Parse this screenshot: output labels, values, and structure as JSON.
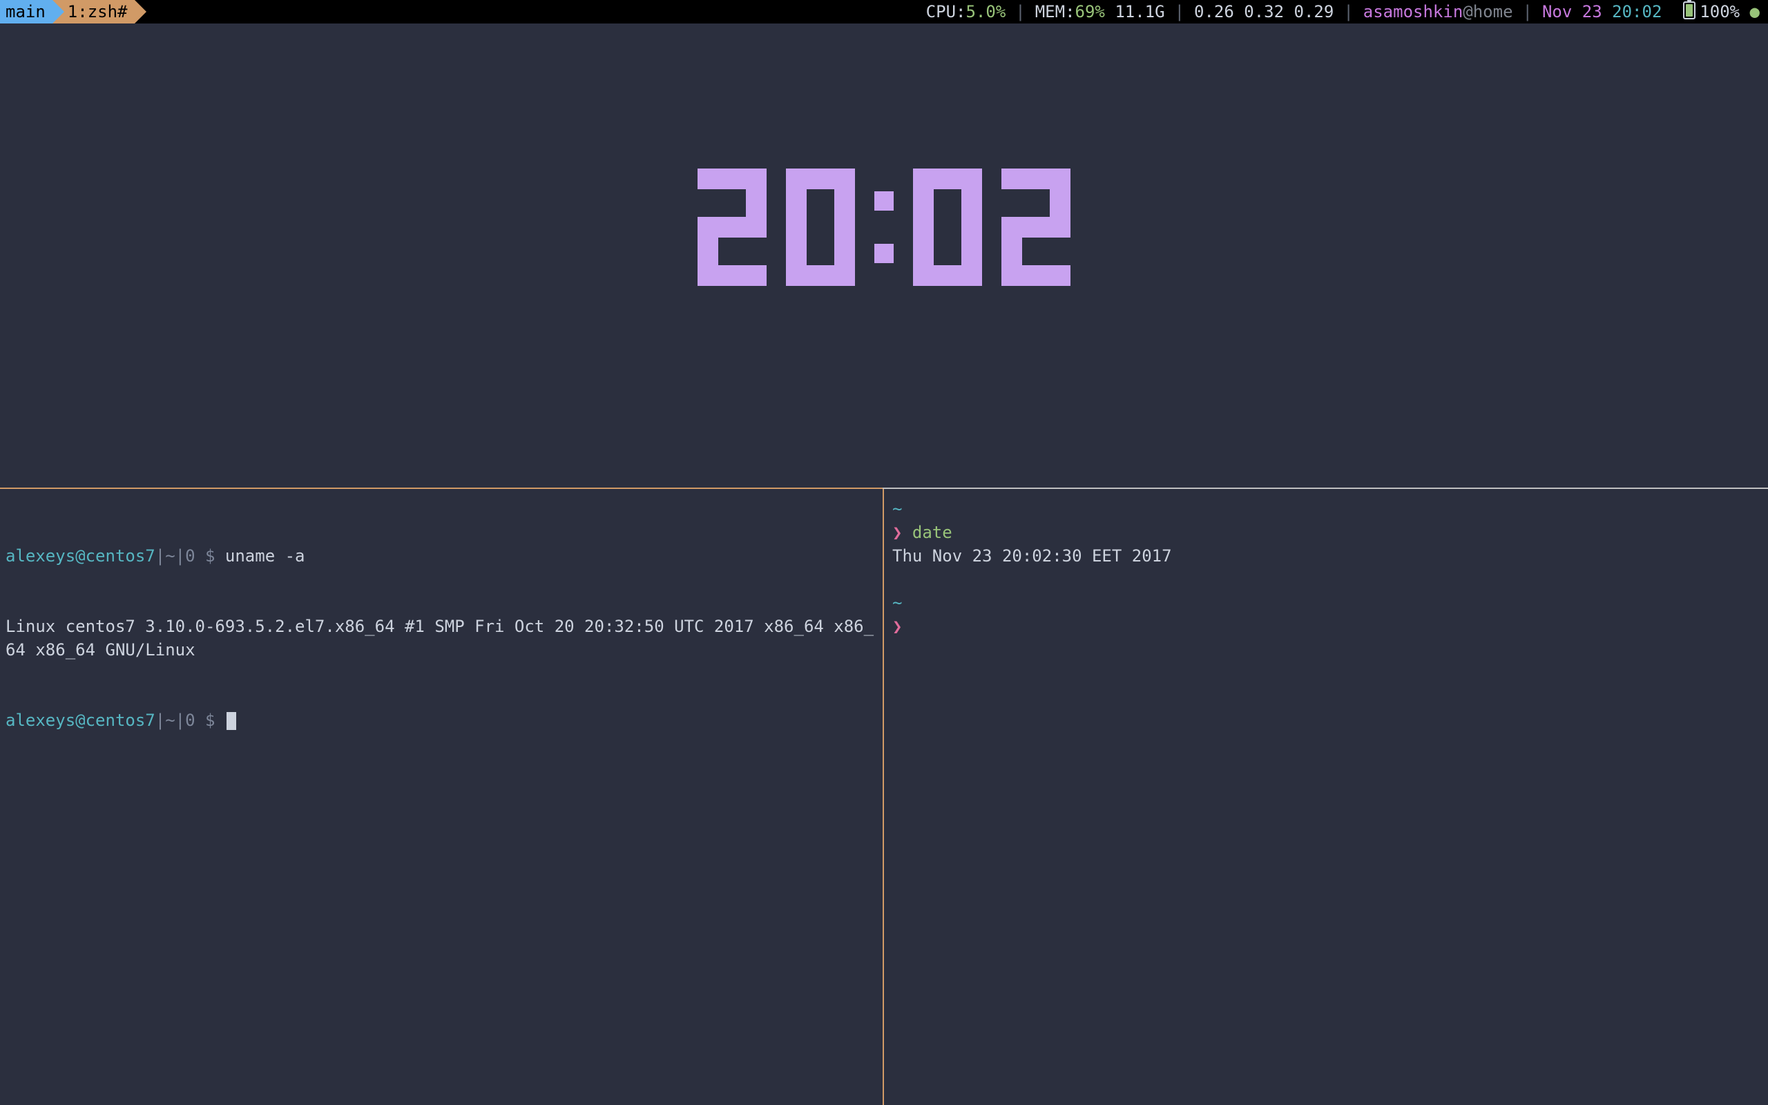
{
  "status": {
    "session": "main",
    "window": "1:zsh#",
    "cpu_label": "CPU:",
    "cpu_value": "5.0%",
    "mem_label": "MEM:",
    "mem_value": "69%",
    "mem_total": "11.1G",
    "load": "0.26 0.32 0.29",
    "user": "asamoshkin",
    "host": "@home",
    "date": "Nov 23",
    "time": "20:02",
    "battery_pct": "100%",
    "dot": "●",
    "sep": "|"
  },
  "clock": {
    "h1": "2",
    "h2": "0",
    "m1": "0",
    "m2": "2"
  },
  "left_pane": {
    "prompt_user": "alexeys@centos7",
    "prompt_path": "|~|0 $ ",
    "cmd1": "uname -a",
    "output1": "Linux centos7 3.10.0-693.5.2.el7.x86_64 #1 SMP Fri Oct 20 20:32:50 UTC 2017 x86_64 x86_64 x86_64 GNU/Linux",
    "prompt2_user": "alexeys@centos7",
    "prompt2_path": "|~|0 $ "
  },
  "right_pane": {
    "tilde": "~",
    "prompt": "❯",
    "cmd": "date",
    "output": "Thu Nov 23 20:02:30 EET 2017"
  }
}
